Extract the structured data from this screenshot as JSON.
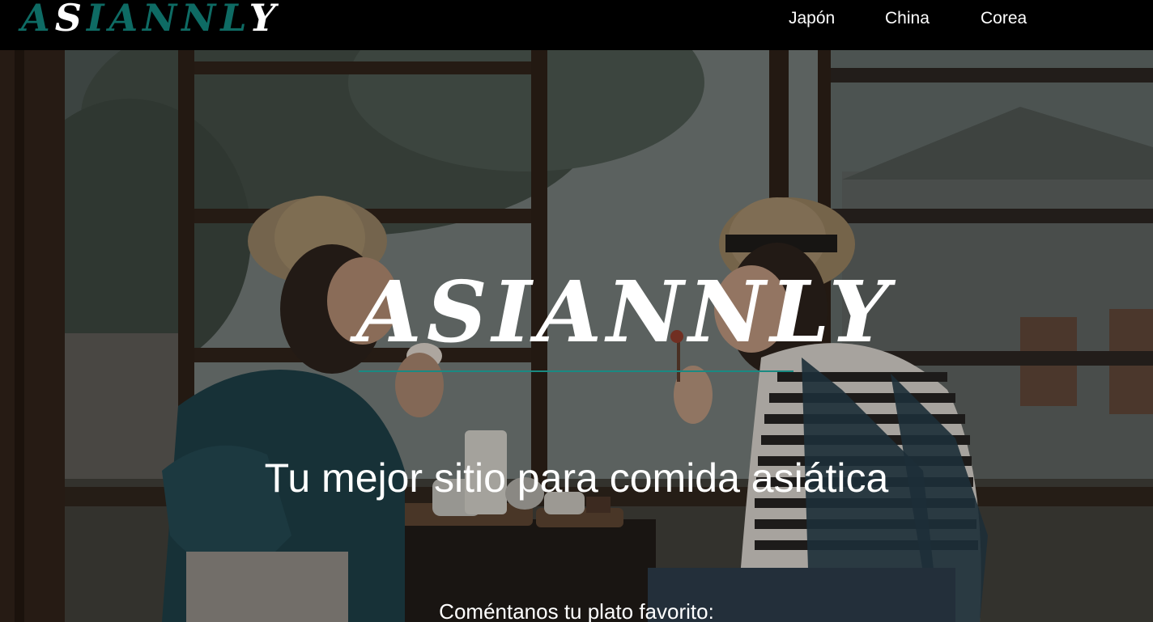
{
  "header": {
    "logo": {
      "part1": "A",
      "part2": "S",
      "part3": "IANNL",
      "part4": "Y"
    },
    "nav": [
      {
        "label": "Japón"
      },
      {
        "label": "China"
      },
      {
        "label": "Corea"
      }
    ]
  },
  "hero": {
    "title": "ASIANNLY",
    "tagline": "Tu mejor sitio para comida asiática",
    "prompt": "Coméntanos tu plato favorito:"
  },
  "colors": {
    "accent": "#0e6b64",
    "rule": "#1a8a82",
    "text": "#ffffff",
    "header_bg": "#000000"
  }
}
